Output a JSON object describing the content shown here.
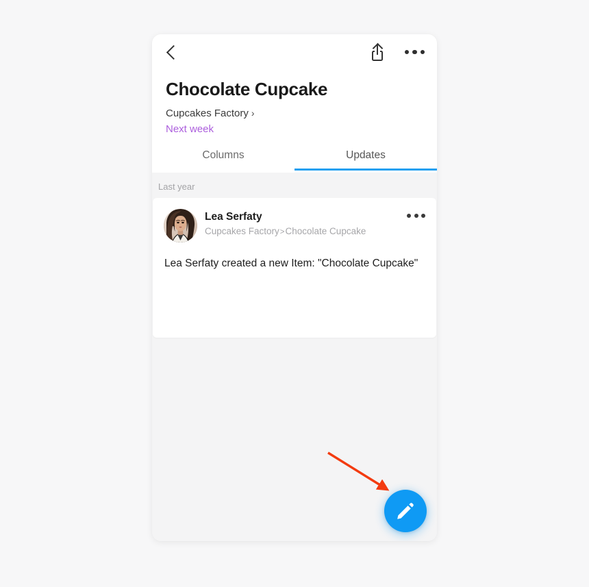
{
  "app": {
    "title": "Chocolate Cupcake",
    "board": "Cupcakes Factory",
    "board_chevron": "›",
    "group": "Next week",
    "group_color": "#ac5fdd",
    "accent_color": "#21a0f0"
  },
  "topbar": {
    "back_icon": "back-chevron-icon",
    "share_icon": "share-icon",
    "more_icon": "more-options-icon"
  },
  "tabs": [
    {
      "label": "Columns",
      "active": false
    },
    {
      "label": "Updates",
      "active": true
    }
  ],
  "feed": {
    "date_label": "Last year",
    "updates": [
      {
        "author": "Lea Serfaty",
        "avatar": "user-avatar-photo",
        "breadcrumb_board": "Cupcakes Factory",
        "breadcrumb_sep": ">",
        "breadcrumb_item": "Chocolate Cupcake",
        "body": "Lea Serfaty created a new Item: \"Chocolate Cupcake\"",
        "more_icon": "update-more-options-icon"
      }
    ]
  },
  "fab": {
    "icon": "pencil-edit-icon",
    "color": "#0f9af4"
  },
  "annotation": {
    "arrow_color": "#f33b10",
    "points_to": "fab-new-update-button"
  }
}
